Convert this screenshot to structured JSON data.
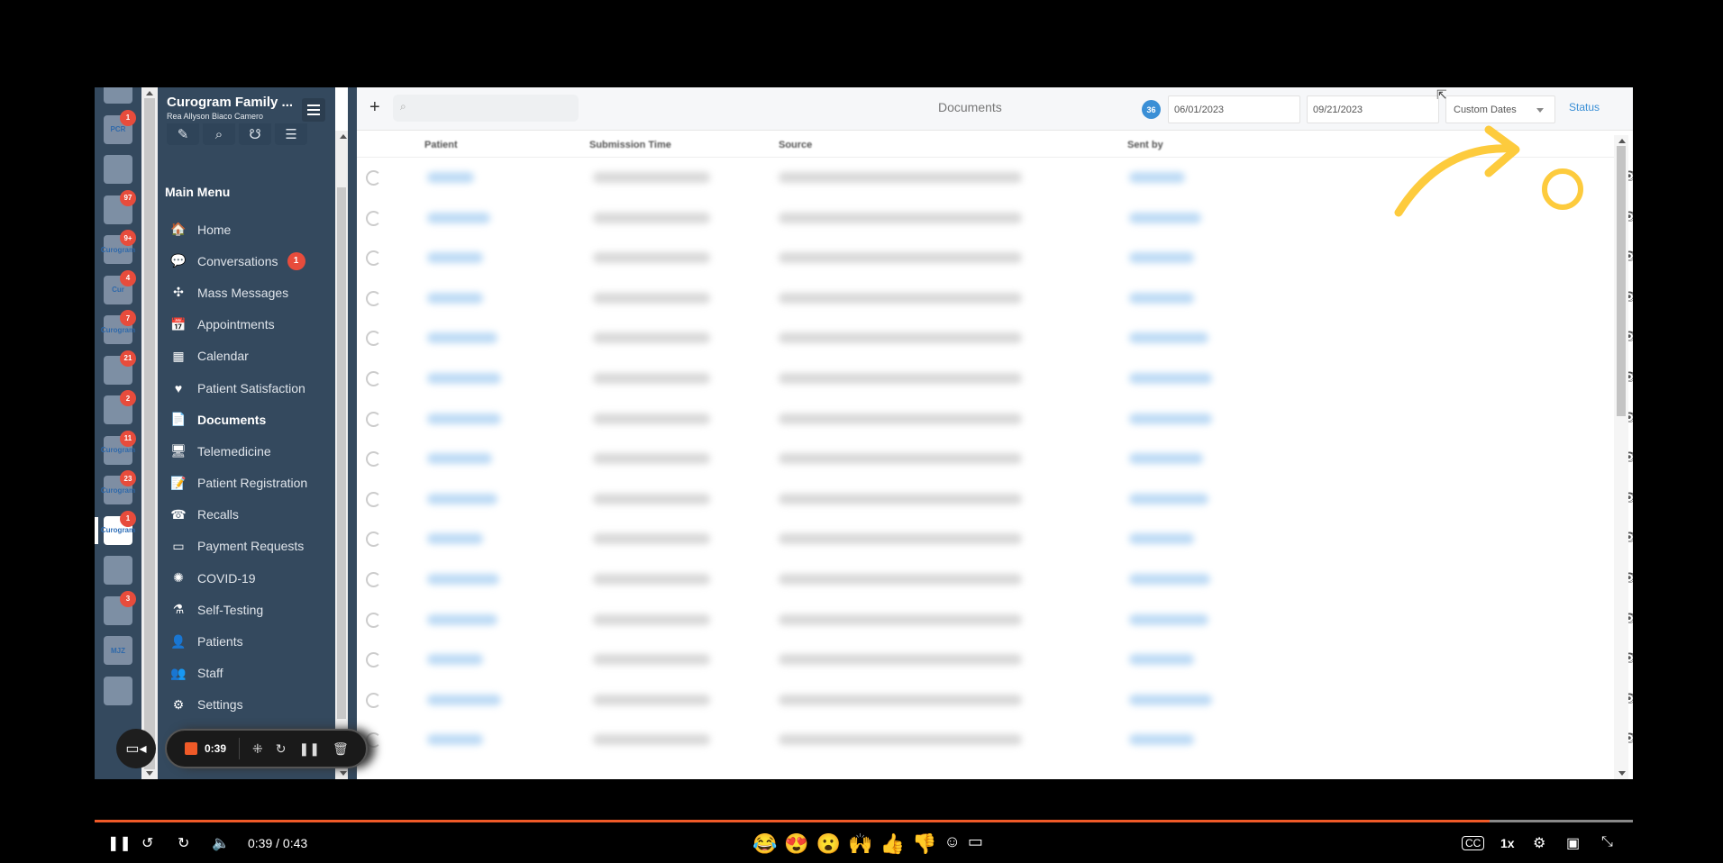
{
  "app_column": {
    "tiles": [
      {
        "label": "",
        "badge": null
      },
      {
        "label": "PCR",
        "badge": "1"
      },
      {
        "label": "",
        "badge": null
      },
      {
        "label": "",
        "badge": "97"
      },
      {
        "label": "Curogram",
        "badge": "9+"
      },
      {
        "label": "Cur",
        "badge": "4"
      },
      {
        "label": "Curogram",
        "badge": "7"
      },
      {
        "label": "",
        "badge": "21"
      },
      {
        "label": "",
        "badge": "2"
      },
      {
        "label": "Curogram",
        "badge": "11"
      },
      {
        "label": "Curogram",
        "badge": "23"
      },
      {
        "label": "Curogram",
        "badge": "1"
      },
      {
        "label": "",
        "badge": null
      },
      {
        "label": "",
        "badge": "3"
      },
      {
        "label": "MJZ",
        "badge": null
      },
      {
        "label": "",
        "badge": null
      }
    ]
  },
  "sidebar": {
    "org_name": "Curogram Family ...",
    "user_name": "Rea Allyson Biaco Camero",
    "quick_icons": [
      "compose-icon",
      "search-icon",
      "stethoscope-icon",
      "filters-icon"
    ],
    "main_menu_title": "Main Menu",
    "items": [
      {
        "label": "Home",
        "icon": "🏠",
        "badge": null,
        "active": false
      },
      {
        "label": "Conversations",
        "icon": "💬",
        "badge": "1",
        "active": false
      },
      {
        "label": "Mass Messages",
        "icon": "✣",
        "badge": null,
        "active": false
      },
      {
        "label": "Appointments",
        "icon": "📅",
        "badge": null,
        "active": false
      },
      {
        "label": "Calendar",
        "icon": "▦",
        "badge": null,
        "active": false
      },
      {
        "label": "Patient Satisfaction",
        "icon": "♥",
        "badge": null,
        "active": false
      },
      {
        "label": "Documents",
        "icon": "📄",
        "badge": null,
        "active": true
      },
      {
        "label": "Telemedicine",
        "icon": "🖥",
        "badge": null,
        "active": false
      },
      {
        "label": "Patient Registration",
        "icon": "📝",
        "badge": null,
        "active": false
      },
      {
        "label": "Recalls",
        "icon": "☎",
        "badge": null,
        "active": false
      },
      {
        "label": "Payment Requests",
        "icon": "▭",
        "badge": null,
        "active": false
      },
      {
        "label": "COVID-19",
        "icon": "✺",
        "badge": null,
        "active": false
      },
      {
        "label": "Self-Testing",
        "icon": "⚗",
        "badge": null,
        "active": false
      },
      {
        "label": "Patients",
        "icon": "👤",
        "badge": null,
        "active": false
      },
      {
        "label": "Staff",
        "icon": "👥",
        "badge": null,
        "active": false
      },
      {
        "label": "Settings",
        "icon": "⚙",
        "badge": null,
        "active": false
      }
    ]
  },
  "recorder": {
    "elapsed": "0:39"
  },
  "topbar": {
    "add_label": "+",
    "search_placeholder": "",
    "title": "Documents",
    "count": "36",
    "date_from": "06/01/2023",
    "date_to": "09/21/2023",
    "range": "Custom Dates",
    "status_label": "Status"
  },
  "table": {
    "columns": [
      "Patient",
      "Submission Time",
      "Source",
      "Sent by"
    ],
    "row_count": 15,
    "row_actions": [
      "view-icon",
      "download-icon",
      "more-icon"
    ],
    "rows_blurred": true
  },
  "annotation": {
    "color": "#fdcb3d",
    "target": "download-icon (first row)"
  },
  "player": {
    "current_time": "0:39",
    "duration": "0:43",
    "progress_fraction": 0.907,
    "speed": "1x",
    "reactions": [
      "😂",
      "😍",
      "😮",
      "🙌",
      "👍",
      "👎"
    ],
    "accent": "#f05a28"
  }
}
